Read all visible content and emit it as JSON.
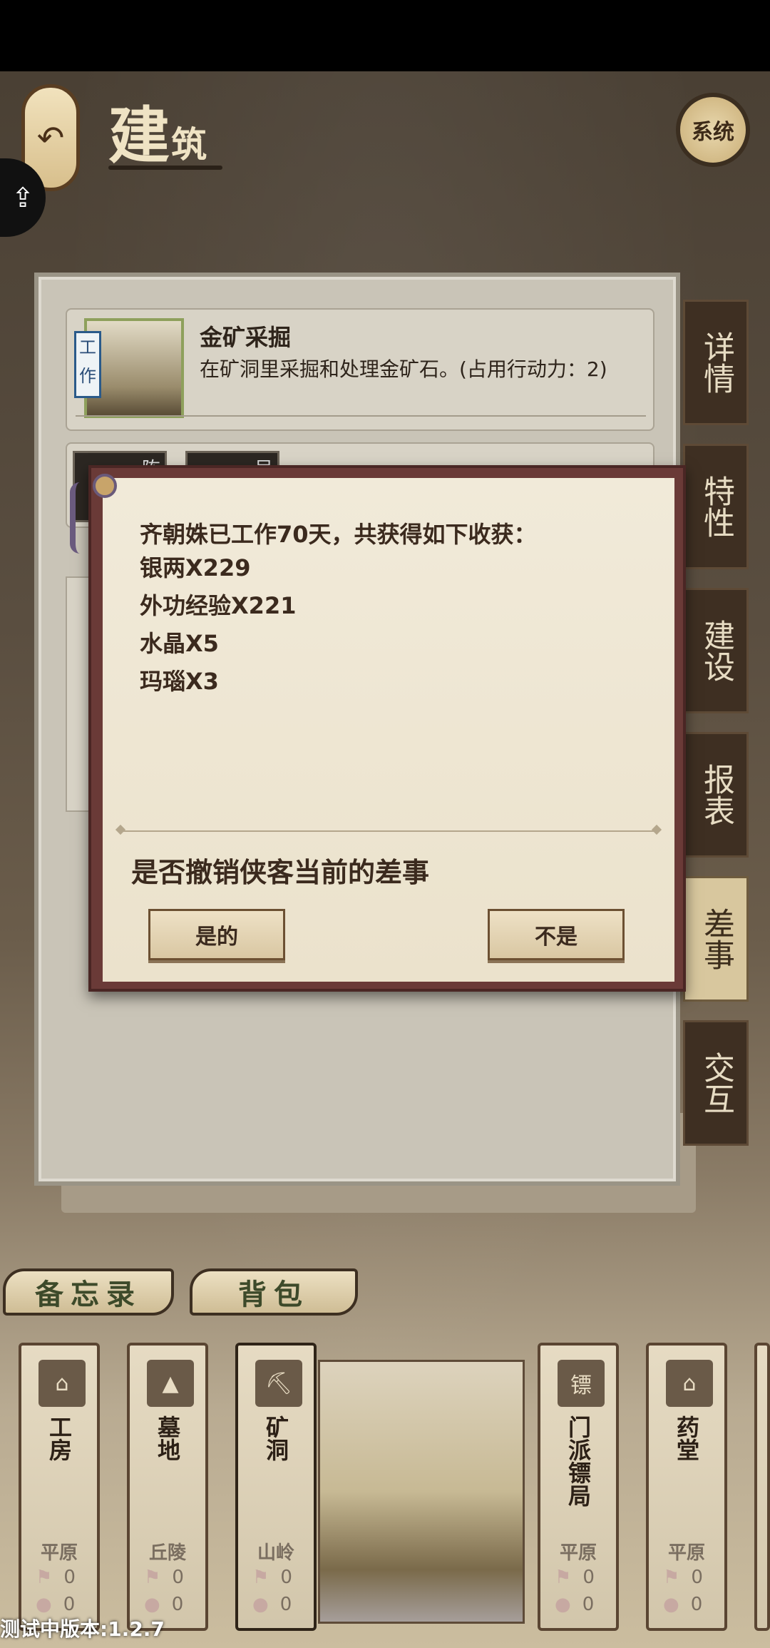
{
  "header": {
    "title_big": "建",
    "title_small": "筑",
    "system_label": "系统",
    "back_icon": "back-arrow-icon"
  },
  "task_card": {
    "tag": "工作",
    "title": "金矿采掘",
    "description": "在矿洞里采掘和处理金矿石。(占用行动力：2)",
    "portraits": [
      "陈",
      "吴"
    ]
  },
  "side_tabs": [
    {
      "label": "详情",
      "active": false
    },
    {
      "label": "特性",
      "active": false
    },
    {
      "label": "建设",
      "active": false
    },
    {
      "label": "报表",
      "active": false
    },
    {
      "label": "差事",
      "active": true
    },
    {
      "label": "交互",
      "active": false
    }
  ],
  "dialog": {
    "message": "齐朝姝已工作70天，共获得如下收获：",
    "rewards": [
      "银两X229",
      "外功经验X221",
      "水晶X5",
      "玛瑙X3"
    ],
    "question": "是否撤销侠客当前的差事",
    "confirm_label": "是的",
    "cancel_label": "不是"
  },
  "bottom_tabs": {
    "memo": "备忘录",
    "bag": "背包"
  },
  "buildings": [
    {
      "name": "工房",
      "terrain": "平原",
      "stat1": "0",
      "stat2": "0"
    },
    {
      "name": "墓地",
      "terrain": "丘陵",
      "stat1": "0",
      "stat2": "0"
    },
    {
      "name": "矿洞",
      "terrain": "山岭",
      "stat1": "0",
      "stat2": "0"
    },
    {
      "name": "门派镖局",
      "terrain": "平原",
      "stat1": "0",
      "stat2": "0"
    },
    {
      "name": "药堂",
      "terrain": "平原",
      "stat1": "0",
      "stat2": "0"
    }
  ],
  "version": "测试中版本:1.2.7"
}
